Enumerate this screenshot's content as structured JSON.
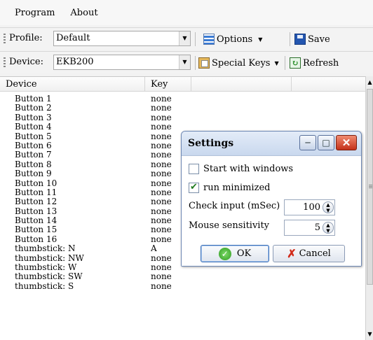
{
  "menu": [
    "Program",
    "About"
  ],
  "profile": {
    "label": "Profile:",
    "value": "Default"
  },
  "options_label": "Options",
  "save_label": "Save",
  "device_bar": {
    "label": "Device:",
    "value": "EKB200"
  },
  "special_keys_label": "Special Keys",
  "refresh_label": "Refresh",
  "columns": {
    "device": "Device",
    "key": "Key",
    "extra1": "",
    "extra2": ""
  },
  "rows": [
    {
      "device": "Button 1",
      "key": "none"
    },
    {
      "device": "Button 2",
      "key": "none"
    },
    {
      "device": "Button 3",
      "key": "none"
    },
    {
      "device": "Button 4",
      "key": "none"
    },
    {
      "device": "Button 5",
      "key": "none"
    },
    {
      "device": "Button 6",
      "key": "none"
    },
    {
      "device": "Button 7",
      "key": "none"
    },
    {
      "device": "Button 8",
      "key": "none"
    },
    {
      "device": "Button 9",
      "key": "none"
    },
    {
      "device": "Button 10",
      "key": "none"
    },
    {
      "device": "Button 11",
      "key": "none"
    },
    {
      "device": "Button 12",
      "key": "none"
    },
    {
      "device": "Button 13",
      "key": "none"
    },
    {
      "device": "Button 14",
      "key": "none"
    },
    {
      "device": "Button 15",
      "key": "none"
    },
    {
      "device": "Button 16",
      "key": "none"
    },
    {
      "device": "thumbstick: N",
      "key": "A"
    },
    {
      "device": "thumbstick: NW",
      "key": "none"
    },
    {
      "device": "thumbstick: W",
      "key": "none"
    },
    {
      "device": "thumbstick: SW",
      "key": "none"
    },
    {
      "device": "thumbstick: S",
      "key": "none"
    }
  ],
  "dialog": {
    "title": "Settings",
    "start_with_windows": {
      "label": "Start with windows",
      "checked": false
    },
    "run_minimized": {
      "label": "run minimized",
      "checked": true
    },
    "check_input": {
      "label": "Check input (mSec)",
      "value": "100"
    },
    "mouse_sensitivity": {
      "label": "Mouse sensitivity",
      "value": "5"
    },
    "ok_label": "OK",
    "cancel_label": "Cancel"
  },
  "icons": {
    "options": "list-icon",
    "save": "floppy-disk-icon",
    "special_keys": "keyboard-icon",
    "refresh": "refresh-icon",
    "ok": "check-circle-icon",
    "cancel": "red-x-icon"
  },
  "colors": {
    "titlebar": "#c9d8ee",
    "close_button": "#c4311a",
    "ok_icon": "#2e9a20"
  }
}
